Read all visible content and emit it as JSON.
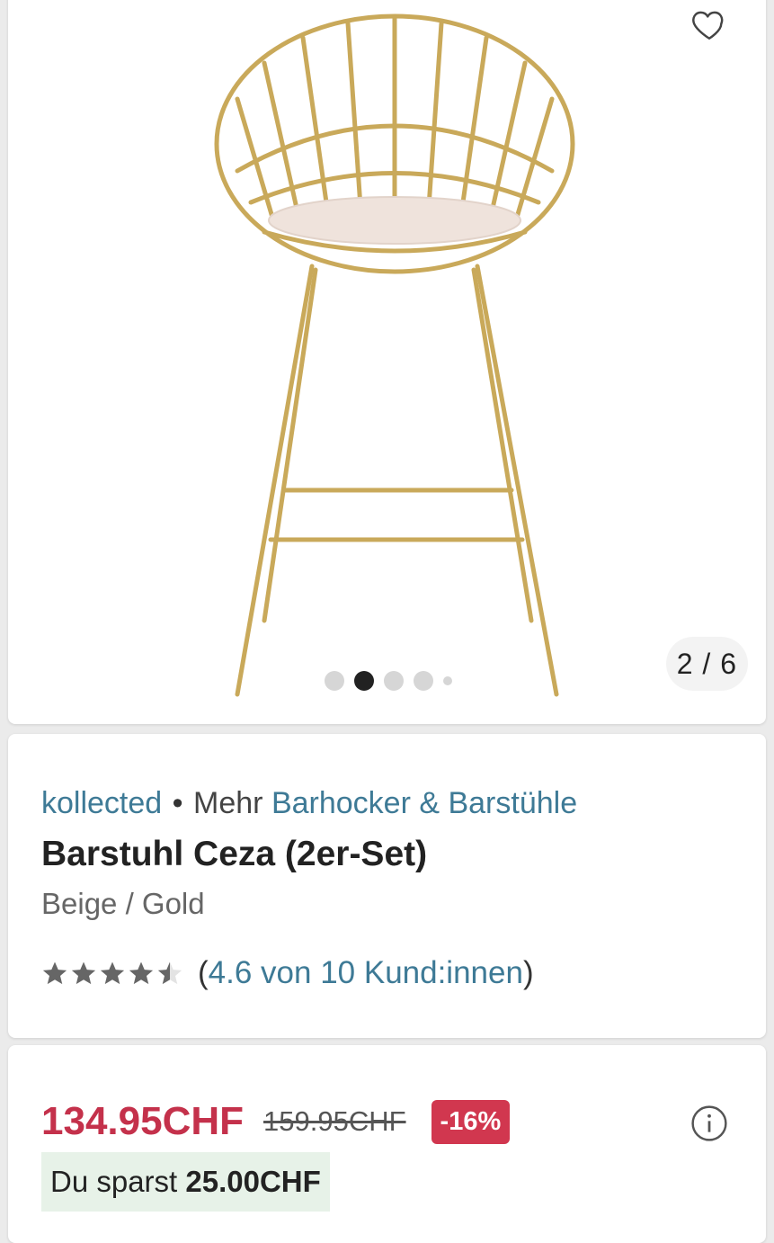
{
  "gallery": {
    "counter": "2 / 6",
    "active_dot": 1,
    "colors": {
      "frame": "#c9a95a",
      "cushion": "#efe3dc"
    }
  },
  "product": {
    "brand": "kollected",
    "separator": "•",
    "more_label": "Mehr",
    "category": "Barhocker & Barstühle",
    "title": "Barstuhl Ceza (2er-Set)",
    "variant": "Beige / Gold",
    "rating_value": 4.6,
    "rating_open": "(",
    "rating_text": "4.6 von 10 Kund:innen",
    "rating_close": ")"
  },
  "pricing": {
    "current_price": "134.95CHF",
    "original_price": "159.95CHF",
    "discount": "-16%",
    "savings_label": "Du sparst",
    "savings_amount": "25.00CHF",
    "colors": {
      "price": "#c4314b",
      "badge": "#d1374f",
      "savings_bg": "#e7f2e8",
      "link": "#3e7a96"
    }
  }
}
